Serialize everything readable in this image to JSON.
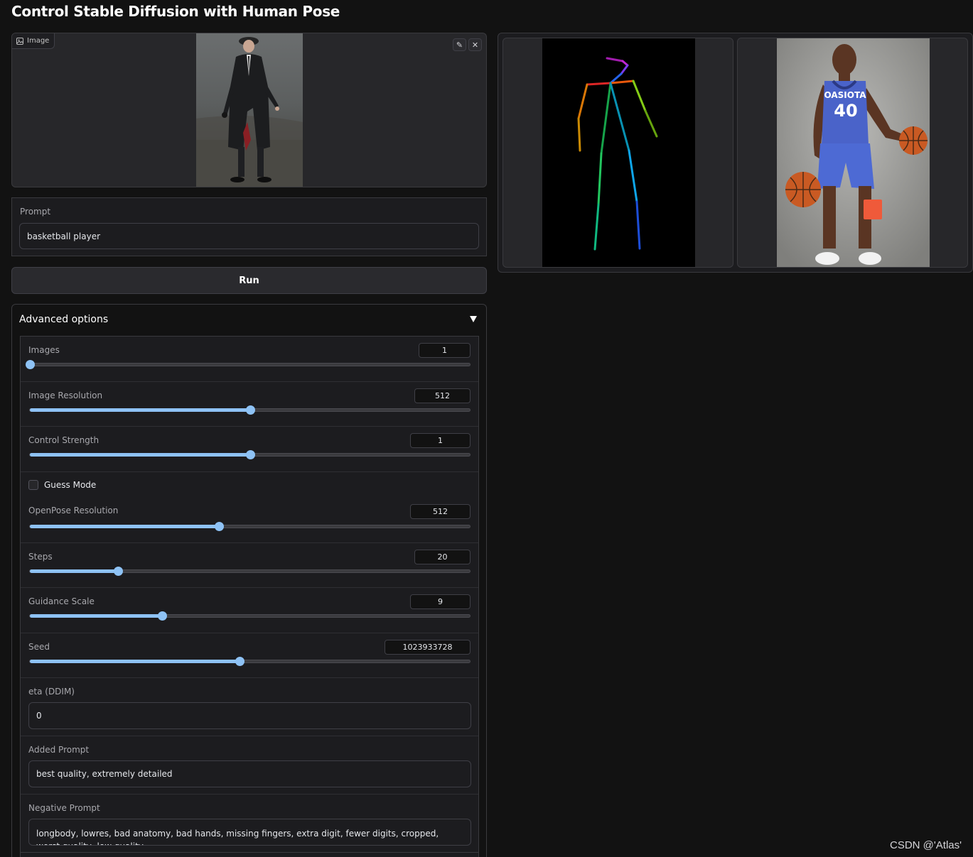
{
  "page": {
    "title": "Control Stable Diffusion with Human Pose"
  },
  "image_input": {
    "tag_label": "Image",
    "edit_icon": "pencil-icon",
    "clear_icon": "close-icon",
    "photo": "man in long black coat and flat cap walking on a road"
  },
  "prompt": {
    "label": "Prompt",
    "value": "basketball player"
  },
  "run_button": {
    "label": "Run"
  },
  "advanced": {
    "header": "Advanced options",
    "toggle_icon": "triangle-down-icon",
    "images": {
      "label": "Images",
      "value": "1",
      "fraction": 0.0
    },
    "image_resolution": {
      "label": "Image Resolution",
      "value": "512",
      "fraction": 0.5
    },
    "control_strength": {
      "label": "Control Strength",
      "value": "1",
      "fraction": 0.5
    },
    "guess_mode": {
      "label": "Guess Mode",
      "checked": false
    },
    "openpose_resolution": {
      "label": "OpenPose Resolution",
      "value": "512",
      "fraction": 0.43
    },
    "steps": {
      "label": "Steps",
      "value": "20",
      "fraction": 0.2
    },
    "guidance_scale": {
      "label": "Guidance Scale",
      "value": "9",
      "fraction": 0.3
    },
    "seed": {
      "label": "Seed",
      "value": "1023933728",
      "fraction": 0.477
    },
    "eta": {
      "label": "eta (DDIM)",
      "value": "0"
    },
    "added_prompt": {
      "label": "Added Prompt",
      "value": "best quality, extremely detailed"
    },
    "negative_prompt": {
      "label": "Negative Prompt",
      "value": "longbody, lowres, bad anatomy, bad hands, missing fingers, extra digit, fewer digits, cropped, worst quality, low quality"
    }
  },
  "gallery": {
    "items": [
      "openpose skeleton on black background",
      "basketball player in blue jersey number 40 holding two basketballs"
    ],
    "jersey_text": "OASIOTA",
    "jersey_number": "40"
  },
  "watermark": "CSDN @'Atlas'",
  "colors": {
    "accent": "#8ec2f5",
    "background": "#121212",
    "panel": "#1c1c1f"
  }
}
